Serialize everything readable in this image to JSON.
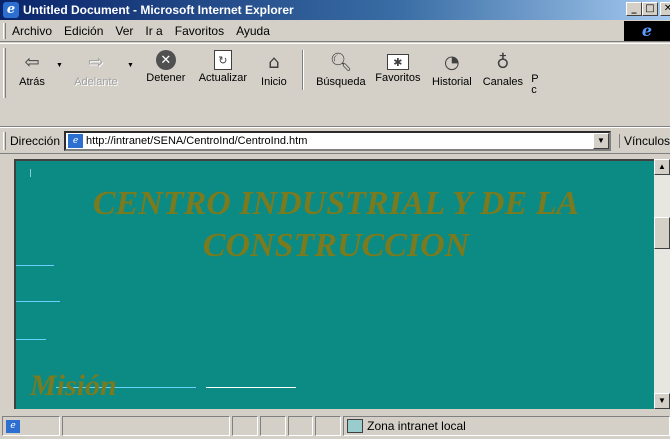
{
  "window": {
    "title": "Untitled Document - Microsoft Internet Explorer",
    "minimize_glyph": "_",
    "maximize_glyph": "□",
    "close_glyph": "✕"
  },
  "menu": {
    "items": [
      "Archivo",
      "Edición",
      "Ver",
      "Ir a",
      "Favoritos",
      "Ayuda"
    ],
    "brand_glyph": "e"
  },
  "toolbar": {
    "back": "Atrás",
    "forward": "Adelante",
    "stop": "Detener",
    "refresh": "Actualizar",
    "home": "Inicio",
    "search": "Búsqueda",
    "favorites": "Favoritos",
    "history": "Historial",
    "channels": "Canales",
    "fullscreen_partial": "P\nc"
  },
  "address": {
    "label": "Dirección",
    "url": "http://intranet/SENA/CentroInd/CentroInd.htm",
    "links_label": "Vínculos"
  },
  "page": {
    "heading": "CENTRO INDUSTRIAL Y DE LA CONSTRUCCION",
    "subheading": "Misión"
  },
  "status": {
    "zone": "Zona intranet local"
  },
  "colors": {
    "page_background": "#0c8a84",
    "heading_text": "#7a7a1e",
    "title_bar": "#0a246a"
  },
  "icons": {
    "back": "arrow-left-icon",
    "forward": "arrow-right-icon",
    "stop": "stop-icon",
    "refresh": "refresh-icon",
    "home": "home-icon",
    "search": "search-icon",
    "favorites": "favorites-icon",
    "history": "history-icon",
    "channels": "channels-icon"
  }
}
